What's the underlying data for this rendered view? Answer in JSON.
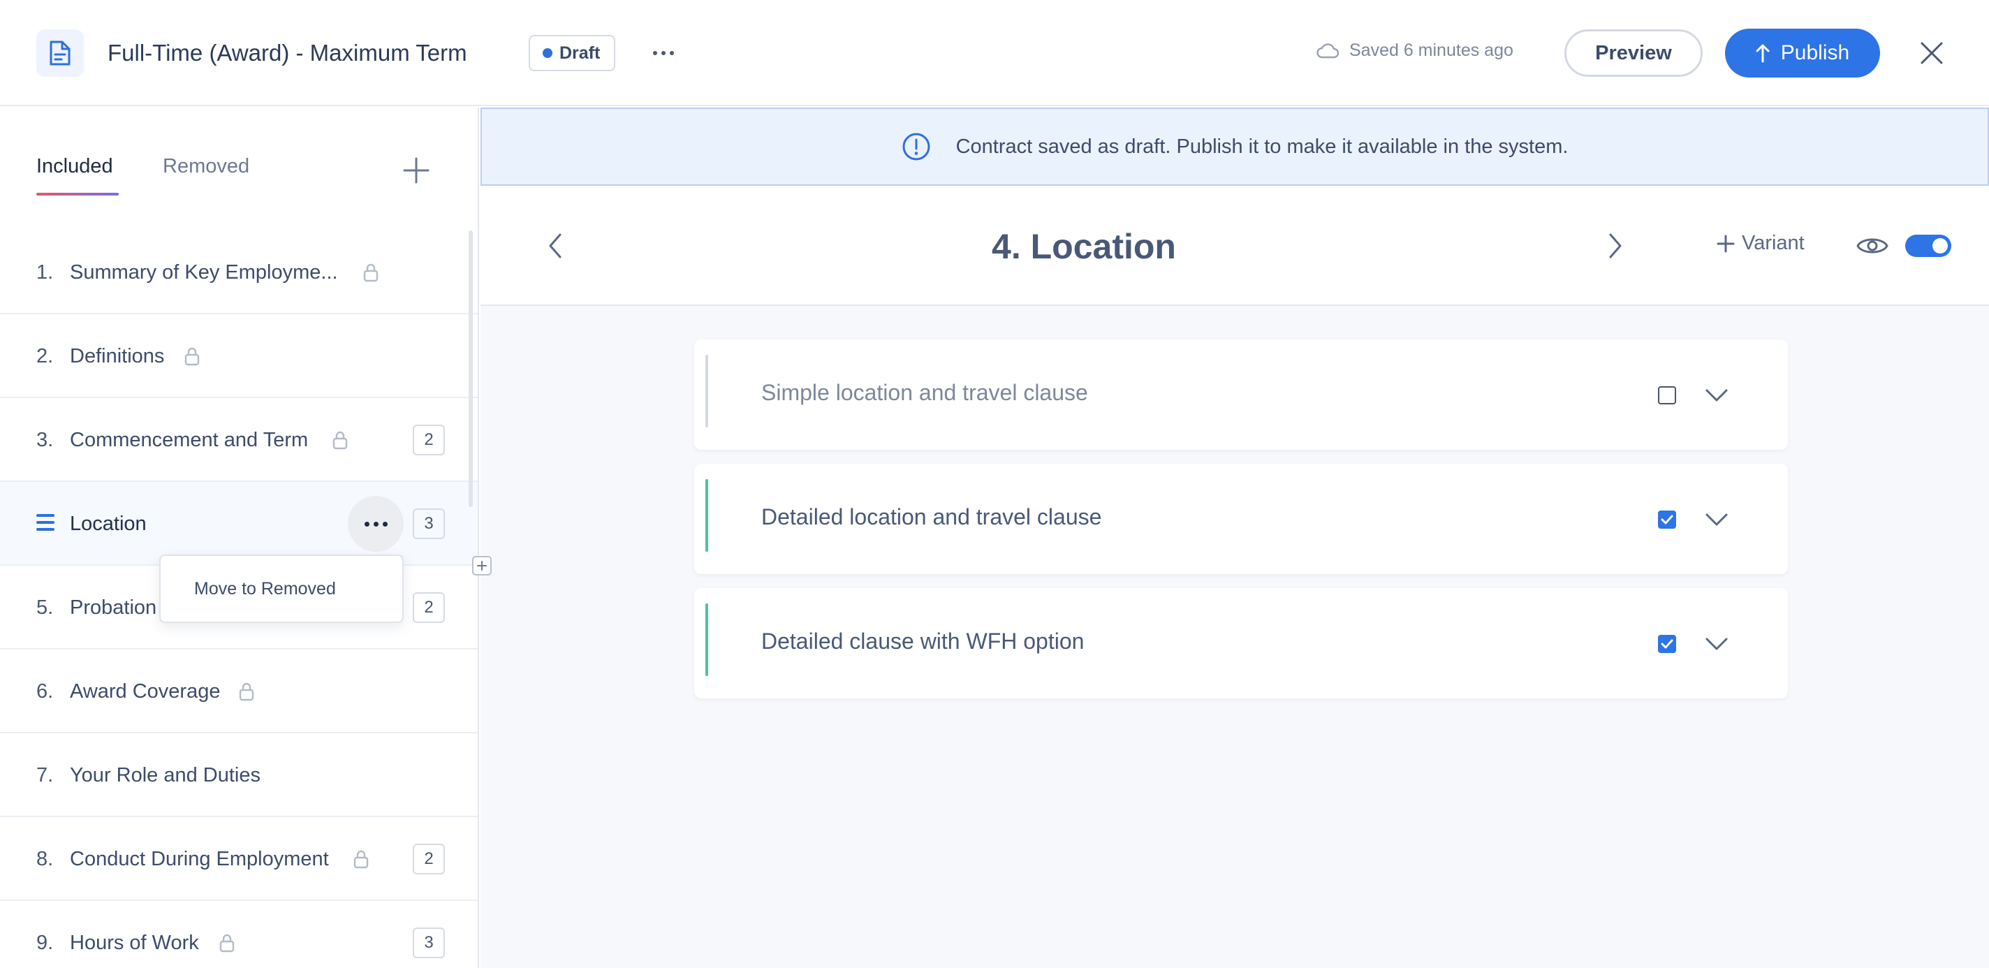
{
  "header": {
    "title": "Full-Time (Award) - Maximum Term",
    "status": "Draft",
    "saved_text": "Saved 6 minutes ago",
    "preview_label": "Preview",
    "publish_label": "Publish"
  },
  "sidebar": {
    "tabs": [
      "Included",
      "Removed"
    ],
    "active_tab": "Included",
    "items": [
      {
        "num": "1.",
        "label": "Summary of Key Employme...",
        "locked": true,
        "count": ""
      },
      {
        "num": "2.",
        "label": "Definitions",
        "locked": true,
        "count": ""
      },
      {
        "num": "3.",
        "label": "Commencement and Term",
        "locked": true,
        "count": "2"
      },
      {
        "num": "",
        "label": "Location",
        "locked": false,
        "count": "3",
        "active": true
      },
      {
        "num": "5.",
        "label": "Probation",
        "locked": false,
        "count": "2"
      },
      {
        "num": "6.",
        "label": "Award Coverage",
        "locked": true,
        "count": ""
      },
      {
        "num": "7.",
        "label": "Your Role and Duties",
        "locked": false,
        "count": ""
      },
      {
        "num": "8.",
        "label": "Conduct During Employment",
        "locked": true,
        "count": "2"
      },
      {
        "num": "9.",
        "label": "Hours of Work",
        "locked": true,
        "count": "3"
      }
    ],
    "context_menu": {
      "item": "Move to Removed"
    }
  },
  "main": {
    "banner": "Contract saved as draft. Publish it to make it available in the system.",
    "section_title": "4. Location",
    "add_variant_label": "Variant",
    "clauses": [
      {
        "label": "Simple location and travel clause",
        "checked": false
      },
      {
        "label": "Detailed location and travel clause",
        "checked": true
      },
      {
        "label": "Detailed clause with WFH option",
        "checked": true
      }
    ]
  },
  "colors": {
    "accent": "#2d74e6",
    "included_bar": "#4cc2a2",
    "banner_bg": "#eaf2fd"
  },
  "icons": [
    "document-icon",
    "cloud-icon",
    "upload-arrow-icon",
    "close-icon",
    "plus-icon",
    "lock-icon",
    "drag-handle-icon",
    "more-icon",
    "info-icon",
    "chevron-left-icon",
    "chevron-right-icon",
    "eye-icon",
    "chevron-down-icon"
  ]
}
